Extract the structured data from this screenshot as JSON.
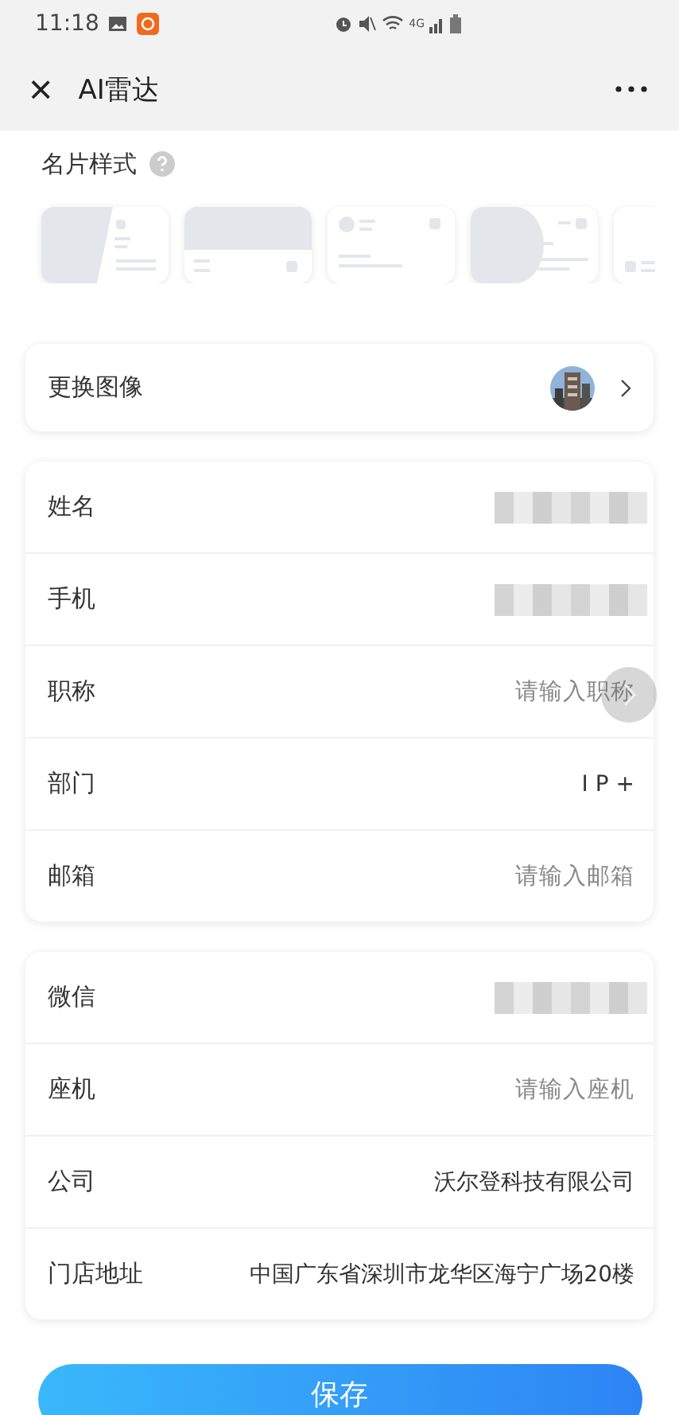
{
  "status_bar": {
    "time": "11:18",
    "network": "4G"
  },
  "nav": {
    "close": "×",
    "title": "AI雷达"
  },
  "card_styles": {
    "title": "名片样式",
    "styles": [
      {
        "kind": "split"
      },
      {
        "kind": "banner"
      },
      {
        "kind": "plain"
      },
      {
        "kind": "round"
      },
      {
        "kind": "corner"
      }
    ]
  },
  "avatar_row": {
    "label": "更换图像"
  },
  "groups": [
    [
      {
        "label": "姓名",
        "kind": "blurred"
      },
      {
        "label": "手机",
        "kind": "blurred"
      },
      {
        "label": "职称",
        "kind": "placeholder",
        "placeholder": "请输入职称"
      },
      {
        "label": "部门",
        "kind": "value",
        "value": "I P +"
      },
      {
        "label": "邮箱",
        "kind": "placeholder",
        "placeholder": "请输入邮箱"
      }
    ],
    [
      {
        "label": "微信",
        "kind": "blurred"
      },
      {
        "label": "座机",
        "kind": "placeholder",
        "placeholder": "请输入座机"
      },
      {
        "label": "公司",
        "kind": "value",
        "value": "沃尔登科技有限公司"
      },
      {
        "label": "门店地址",
        "kind": "value",
        "value": "中国广东省深圳市龙华区海宁广场20楼"
      }
    ]
  ],
  "save_button": "保存"
}
